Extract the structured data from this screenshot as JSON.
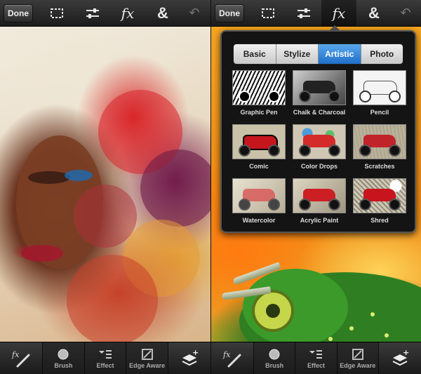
{
  "left_screen": {
    "topbar": {
      "done_label": "Done",
      "tools": [
        "select-tool",
        "adjust-tool",
        "fx-tool",
        "combine-tool",
        "undo-tool"
      ],
      "fx_glyph": "fx",
      "combine_glyph": "&",
      "undo_glyph": "↶"
    },
    "bottombar": {
      "items": [
        {
          "label": "Brush"
        },
        {
          "label": "Effect"
        },
        {
          "label": "Edge Aware"
        }
      ]
    }
  },
  "right_screen": {
    "topbar": {
      "done_label": "Done",
      "active_tool": "fx-tool",
      "fx_glyph": "fx",
      "combine_glyph": "&",
      "undo_glyph": "↶"
    },
    "filter_panel": {
      "tabs": [
        {
          "label": "Basic"
        },
        {
          "label": "Stylize"
        },
        {
          "label": "Artistic",
          "selected": true
        },
        {
          "label": "Photo"
        }
      ],
      "filters": [
        {
          "label": "Graphic Pen"
        },
        {
          "label": "Chalk & Charcoal"
        },
        {
          "label": "Pencil"
        },
        {
          "label": "Comic"
        },
        {
          "label": "Color Drops"
        },
        {
          "label": "Scratches"
        },
        {
          "label": "Watercolor"
        },
        {
          "label": "Acrylic Paint"
        },
        {
          "label": "Shred"
        }
      ]
    },
    "bottombar": {
      "items": [
        {
          "label": "Brush"
        },
        {
          "label": "Effect"
        },
        {
          "label": "Edge Aware"
        }
      ]
    }
  },
  "colors": {
    "active_tab": "#2f86dc",
    "panel_bg": "#141414",
    "toolbar_bg": "#2a2a2a"
  }
}
